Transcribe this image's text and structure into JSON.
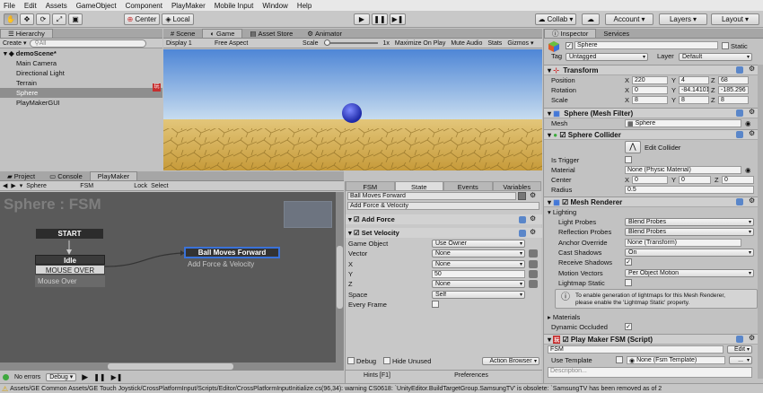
{
  "menu": [
    "File",
    "Edit",
    "Assets",
    "GameObject",
    "Component",
    "PlayMaker",
    "Mobile Input",
    "Window",
    "Help"
  ],
  "toolbar": {
    "center": "Center",
    "local": "Local",
    "collab": "Collab ▾",
    "account": "Account",
    "layers": "Layers",
    "layout": "Layout"
  },
  "hierarchy": {
    "tab": "Hierarchy",
    "create": "Create ▾",
    "search": "All",
    "scene": "demoScene*",
    "items": [
      "Main Camera",
      "Directional Light",
      "Terrain",
      "Sphere",
      "PlayMakerGUI"
    ]
  },
  "scene_tabs": {
    "scene": "Scene",
    "game": "Game",
    "asset_store": "Asset Store",
    "animator": "Animator"
  },
  "game_bar": {
    "display": "Display 1",
    "aspect": "Free Aspect",
    "scale_label": "Scale",
    "scale_value": "1x",
    "maximize": "Maximize On Play",
    "mute": "Mute Audio",
    "stats": "Stats",
    "gizmos": "Gizmos ▾"
  },
  "bottom_tabs": {
    "project": "Project",
    "console": "Console",
    "playmaker": "PlayMaker"
  },
  "fsm_bar": {
    "object": "Sphere",
    "fsm": "FSM",
    "lock": "Lock",
    "select": "Select"
  },
  "fsm_graph": {
    "title": "Sphere : FSM",
    "start": "START",
    "idle": "Idle",
    "mouse_over": "MOUSE OVER",
    "mouse_over_event": "Mouse Over",
    "ball": "Ball Moves Forward",
    "ball_action": "Add Force & Velocity"
  },
  "fsm_bottom": {
    "errors": "No errors",
    "debug": "Debug ▾"
  },
  "state_panel": {
    "tabs": [
      "FSM",
      "State",
      "Events",
      "Variables"
    ],
    "state_name": "Ball Moves Forward",
    "description": "Add Force & Velocity",
    "action1": "Add Force",
    "action2": "Set Velocity",
    "fields": [
      {
        "label": "Game Object",
        "value": "Use Owner"
      },
      {
        "label": "Vector",
        "value": "None"
      },
      {
        "label": "X",
        "value": "None"
      },
      {
        "label": "Y",
        "value": "50"
      },
      {
        "label": "Z",
        "value": "None"
      },
      {
        "label": "Space",
        "value": "Self"
      },
      {
        "label": "Every Frame",
        "value": ""
      }
    ],
    "debug": "Debug",
    "hide_unused": "Hide Unused",
    "action_browser": "Action Browser",
    "hints": "Hints [F1]",
    "preferences": "Preferences"
  },
  "inspector": {
    "tab": "Inspector",
    "services": "Services",
    "name": "Sphere",
    "static": "Static",
    "tag_label": "Tag",
    "tag": "Untagged",
    "layer_label": "Layer",
    "layer": "Default",
    "transform": {
      "title": "Transform",
      "position": {
        "label": "Position",
        "x": "220",
        "y": "4",
        "z": "68"
      },
      "rotation": {
        "label": "Rotation",
        "x": "0",
        "y": "-84.14101",
        "z": "-185.296"
      },
      "scale": {
        "label": "Scale",
        "x": "8",
        "y": "8",
        "z": "8"
      }
    },
    "mesh_filter": {
      "title": "Sphere (Mesh Filter)",
      "label": "Mesh",
      "value": "Sphere"
    },
    "collider": {
      "title": "Sphere Collider",
      "edit": "Edit Collider",
      "is_trigger": "Is Trigger",
      "material_label": "Material",
      "material": "None (Physic Material)",
      "center_label": "Center",
      "cx": "0",
      "cy": "0",
      "cz": "0",
      "radius_label": "Radius",
      "radius": "0.5"
    },
    "mesh_renderer": {
      "title": "Mesh Renderer",
      "lighting": "Lighting",
      "rows": [
        {
          "label": "Light Probes",
          "value": "Blend Probes"
        },
        {
          "label": "Reflection Probes",
          "value": "Blend Probes"
        },
        {
          "label": "Anchor Override",
          "value": "None (Transform)"
        },
        {
          "label": "Cast Shadows",
          "value": "On"
        },
        {
          "label": "Receive Shadows",
          "value": ""
        },
        {
          "label": "Motion Vectors",
          "value": "Per Object Motion"
        },
        {
          "label": "Lightmap Static",
          "value": ""
        }
      ],
      "info1": "To enable generation of lightmaps for this Mesh Renderer,",
      "info2": "please enable the 'Lightmap Static' property.",
      "materials": "Materials",
      "dynamic_occluded": "Dynamic Occluded"
    },
    "playmaker": {
      "title": "Play Maker FSM (Script)",
      "fsm": "FSM",
      "edit": "Edit",
      "use_template": "Use Template",
      "template": "None (Fsm Template)",
      "description": "Description..."
    }
  },
  "status": {
    "message": "Assets/GE Common Assets/GE Touch Joystick/CrossPlatformInput/Scripts/Editor/CrossPlatformInputInitialize.cs(96,34): warning CS0618: `UnityEditor.BuildTargetGroup.SamsungTV' is obsolete: `SamsungTV has been removed as of 2"
  },
  "colors": {
    "accent": "#3a72d8",
    "selection": "#8e8e8e",
    "sky": "#88b4e4",
    "ground": "#d9b451",
    "sphere": "#3b48d8"
  }
}
